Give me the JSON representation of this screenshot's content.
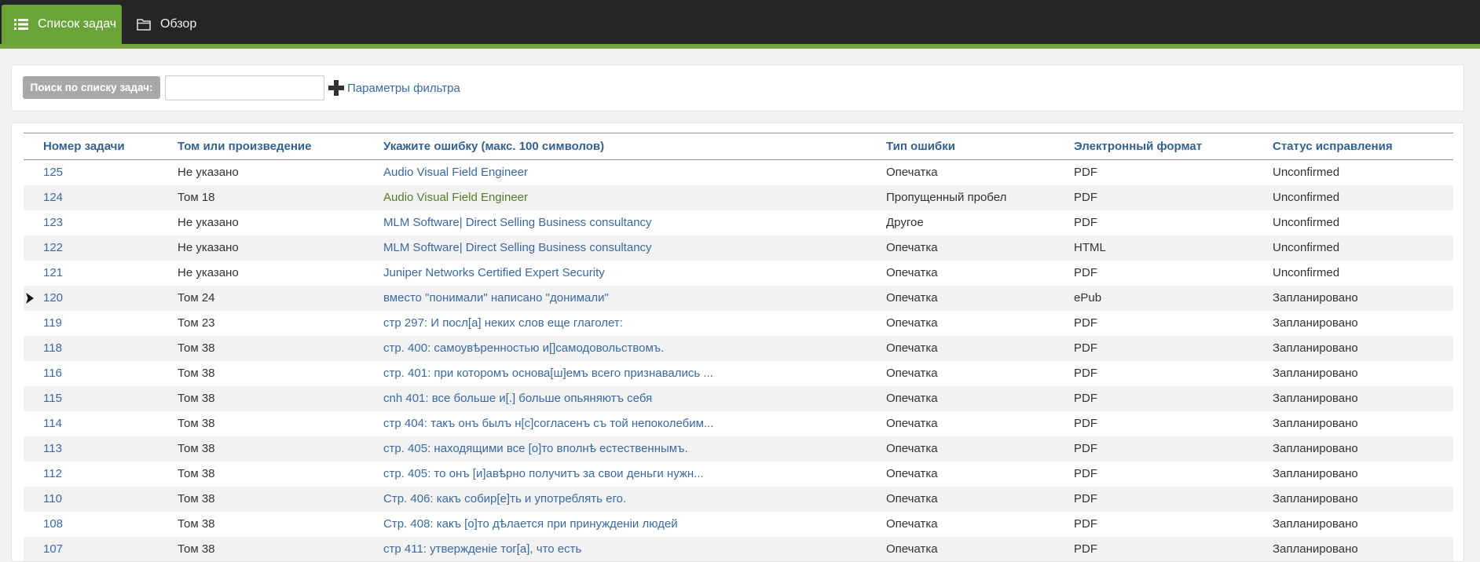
{
  "nav": {
    "tab_tasks": "Список задач",
    "tab_overview": "Обзор"
  },
  "filter": {
    "search_label": "Поиск по списку задач:",
    "search_value": "",
    "params_link": "Параметры фильтра"
  },
  "table": {
    "headers": [
      "Номер задачи",
      "Том или произведение",
      "Укажите ошибку (макс. 100 символов)",
      "Тип ошибки",
      "Электронный формат",
      "Статус исправления"
    ],
    "rows": [
      [
        "125",
        "Не указано",
        "Audio Visual Field Engineer",
        "Опечатка",
        "PDF",
        "Unconfirmed"
      ],
      [
        "124",
        "Том 18",
        "Audio Visual Field Engineer",
        "Пропущенный пробел",
        "PDF",
        "Unconfirmed"
      ],
      [
        "123",
        "Не указано",
        "MLM Software| Direct Selling Business consultancy",
        "Другое",
        "PDF",
        "Unconfirmed"
      ],
      [
        "122",
        "Не указано",
        "MLM Software| Direct Selling Business consultancy",
        "Опечатка",
        "HTML",
        "Unconfirmed"
      ],
      [
        "121",
        "Не указано",
        "Juniper Networks Certified Expert Security",
        "Опечатка",
        "PDF",
        "Unconfirmed"
      ],
      [
        "120",
        "Том 24",
        "вместо \"понимали\" написано \"донимали\"",
        "Опечатка",
        "ePub",
        "Запланировано"
      ],
      [
        "119",
        "Том 23",
        "стр 297: И посл[а] неких слов еще глаголет:",
        "Опечатка",
        "PDF",
        "Запланировано"
      ],
      [
        "118",
        "Том 38",
        "стр. 400: самоувѣренностью и[]самодовольствомъ.",
        "Опечатка",
        "PDF",
        "Запланировано"
      ],
      [
        "116",
        "Том 38",
        "стр. 401: при которомъ основа[ш]емъ всего признавались ...",
        "Опечатка",
        "PDF",
        "Запланировано"
      ],
      [
        "115",
        "Том 38",
        "cnh 401: все больше и[.] больше опьяняютъ себя",
        "Опечатка",
        "PDF",
        "Запланировано"
      ],
      [
        "114",
        "Том 38",
        "стр 404: такъ онъ былъ н[с]согласенъ съ той непоколебим...",
        "Опечатка",
        "PDF",
        "Запланировано"
      ],
      [
        "113",
        "Том 38",
        "стр. 405: находящими все [о]то вполнѣ естественнымъ.",
        "Опечатка",
        "PDF",
        "Запланировано"
      ],
      [
        "112",
        "Том 38",
        "стр. 405: то онъ [и]авѣрно получитъ за свои деньги нужн...",
        "Опечатка",
        "PDF",
        "Запланировано"
      ],
      [
        "110",
        "Том 38",
        "Стр. 406: какъ собир[е]ть и употреблять его.",
        "Опечатка",
        "PDF",
        "Запланировано"
      ],
      [
        "108",
        "Том 38",
        "Стр. 408: какъ [о]то дѣлается при принужденіи людей",
        "Опечатка",
        "PDF",
        "Запланировано"
      ],
      [
        "107",
        "Том 38",
        "стр 411: утвержденіе тог[а], что есть",
        "Опечатка",
        "PDF",
        "Запланировано"
      ]
    ],
    "current_row": "120",
    "highlighted_row": "124"
  }
}
